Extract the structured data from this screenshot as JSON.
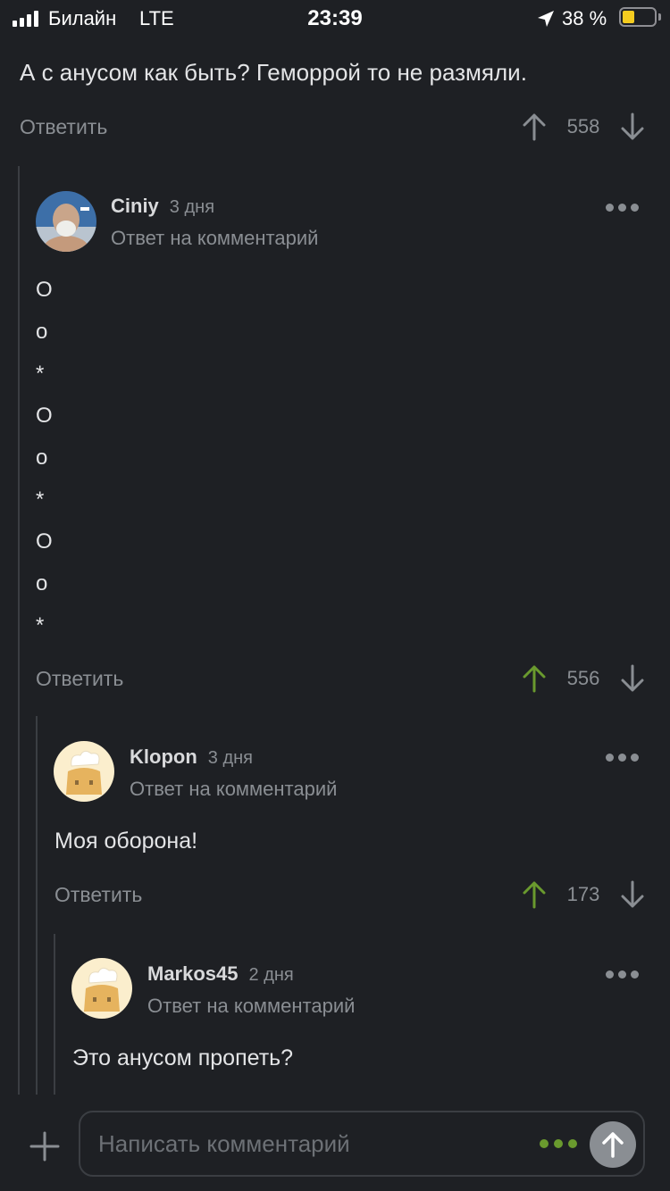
{
  "status_bar": {
    "carrier": "Билайн",
    "network": "LTE",
    "time": "23:39",
    "battery_percent": "38 %",
    "battery_level": 0.38,
    "icons": [
      "signal-icon",
      "location-arrow-icon",
      "battery-icon"
    ]
  },
  "top_comment": {
    "text": "А с анусом как быть? Геморрой то не размяли.",
    "reply_label": "Ответить",
    "rating": "558"
  },
  "comments": [
    {
      "author": "Ciniy",
      "age": "3 дня",
      "reply_to": "Ответ на комментарий",
      "lines": [
        "О",
        "о",
        "*",
        "О",
        "о",
        "*",
        "О",
        "о",
        "*"
      ],
      "reply_label": "Ответить",
      "rating": "556",
      "upvoted": true
    },
    {
      "author": "Klopon",
      "age": "3 дня",
      "reply_to": "Ответ на комментарий",
      "text": "Моя оборона!",
      "reply_label": "Ответить",
      "rating": "173",
      "upvoted": true
    },
    {
      "author": "Markos45",
      "age": "2 дня",
      "reply_to": "Ответ на комментарий",
      "text": "Это анусом пропеть?"
    }
  ],
  "composer": {
    "placeholder": "Написать комментарий"
  },
  "colors": {
    "background": "#1e2024",
    "text": "#e3e4e6",
    "muted": "#8a8e93",
    "upvote_active": "#6a9a2e",
    "battery": "#f5cc1f"
  }
}
